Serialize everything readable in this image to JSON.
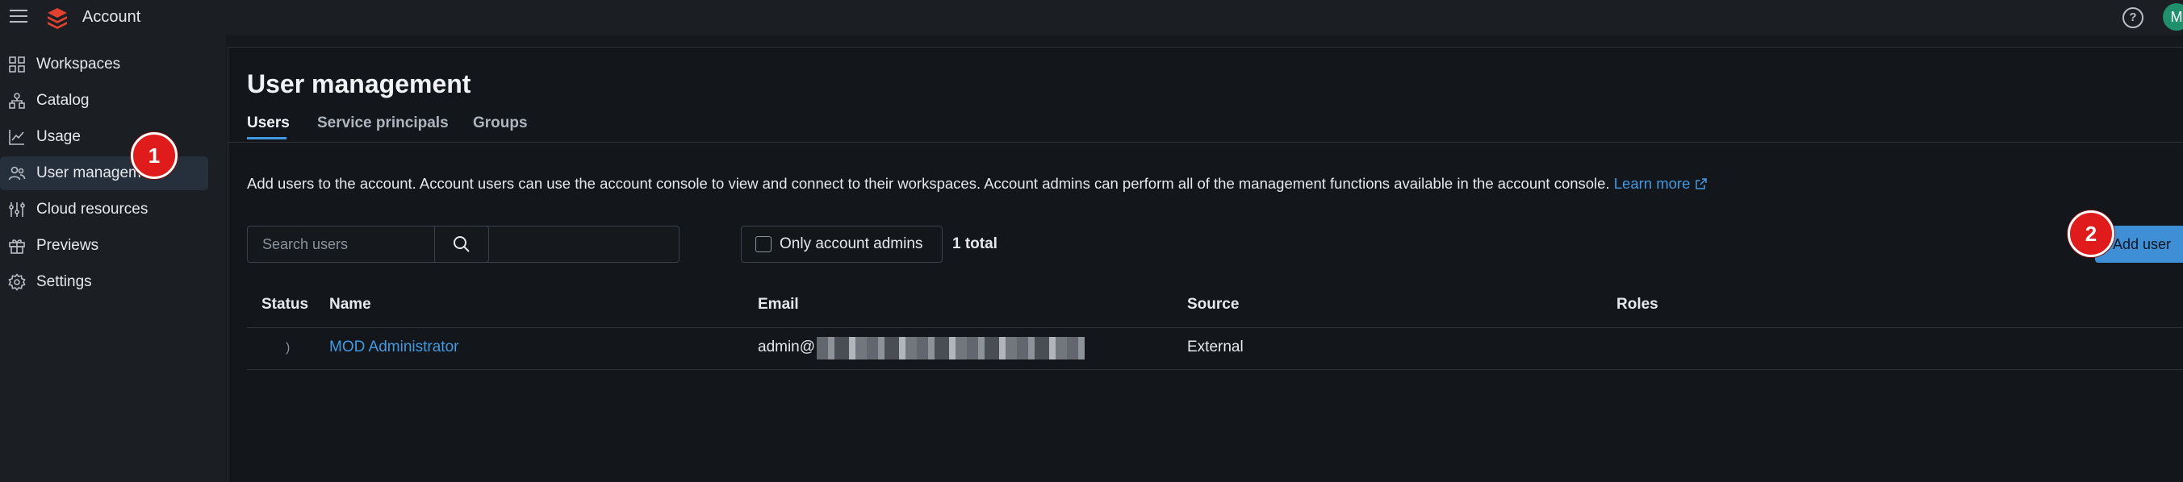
{
  "topbar": {
    "app_title": "Account",
    "help_label": "?",
    "avatar_initial": "M"
  },
  "sidebar": {
    "items": [
      {
        "label": "Workspaces",
        "icon": "workspaces-icon"
      },
      {
        "label": "Catalog",
        "icon": "catalog-icon"
      },
      {
        "label": "Usage",
        "icon": "usage-chart-icon"
      },
      {
        "label": "User management",
        "icon": "users-icon",
        "active": true
      },
      {
        "label": "Cloud resources",
        "icon": "cloud-resources-icon"
      },
      {
        "label": "Previews",
        "icon": "gift-icon"
      },
      {
        "label": "Settings",
        "icon": "gear-icon"
      }
    ]
  },
  "main": {
    "title": "User management",
    "tabs": [
      {
        "label": "Users",
        "active": true
      },
      {
        "label": "Service principals"
      },
      {
        "label": "Groups"
      }
    ],
    "description": "Add users to the account. Account users can use the account console to view and connect to their workspaces. Account admins can perform all of the management functions available in the account console.",
    "learn_more": "Learn more",
    "search": {
      "placeholder": "Search users",
      "value": ""
    },
    "filter_label": "Only account admins",
    "total": "1 total",
    "add_user_label": "Add user",
    "table": {
      "headers": [
        "Status",
        "Name",
        "Email",
        "Source",
        "Roles"
      ],
      "rows": [
        {
          "status": ")",
          "name": "MOD Administrator",
          "email_prefix": "admin@",
          "source": "External",
          "roles": ""
        }
      ]
    }
  },
  "callouts": [
    "1",
    "2"
  ],
  "colors": {
    "accent": "#4299e1",
    "callout_red": "#e01b1b",
    "button_blue": "#3f8fd6"
  }
}
